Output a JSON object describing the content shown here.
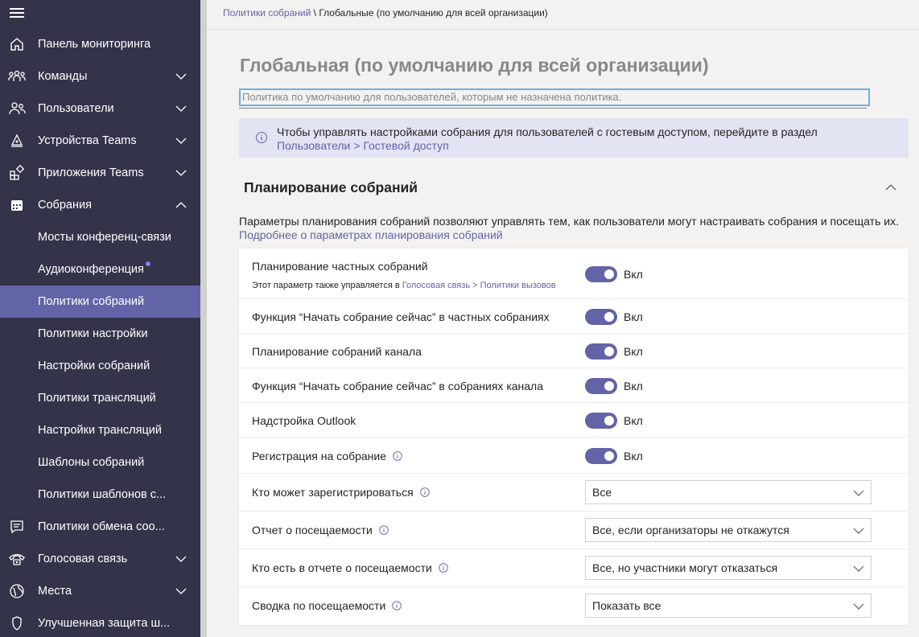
{
  "sidebar": {
    "items": [
      {
        "label": "Панель мониторинга",
        "icon": "home-icon",
        "expandable": false
      },
      {
        "label": "Команды",
        "icon": "teams-icon",
        "expandable": true
      },
      {
        "label": "Пользователи",
        "icon": "users-icon",
        "expandable": true
      },
      {
        "label": "Устройства Teams",
        "icon": "devices-icon",
        "expandable": true
      },
      {
        "label": "Приложения Teams",
        "icon": "apps-icon",
        "expandable": true
      },
      {
        "label": "Собрания",
        "icon": "calendar-icon",
        "expandable": true,
        "expanded": true
      },
      {
        "label": "Мосты конференц-связи",
        "sub": true
      },
      {
        "label": "Аудиоконференция",
        "sub": true,
        "badge_dot": true
      },
      {
        "label": "Политики собраний",
        "sub": true,
        "active": true
      },
      {
        "label": "Политики настройки",
        "sub": true
      },
      {
        "label": "Настройки собраний",
        "sub": true
      },
      {
        "label": "Политики трансляций",
        "sub": true
      },
      {
        "label": "Настройки трансляций",
        "sub": true
      },
      {
        "label": "Шаблоны собраний",
        "sub": true
      },
      {
        "label": "Политики шаблонов с...",
        "sub": true
      },
      {
        "label": "Политики обмена соо...",
        "icon": "messaging-icon",
        "expandable": false
      },
      {
        "label": "Голосовая связь",
        "icon": "phone-icon",
        "expandable": true
      },
      {
        "label": "Места",
        "icon": "globe-icon",
        "expandable": true
      },
      {
        "label": "Улучшенная защита ш...",
        "icon": "shield-icon",
        "expandable": false
      }
    ]
  },
  "breadcrumb": {
    "link": "Политики собраний",
    "separator": " \\ ",
    "current": "Глобальные (по умолчанию для всей организации)"
  },
  "page": {
    "title": "Глобальная (по умолчанию для всей организации)",
    "description_value": "Политика по умолчанию для пользователей, которым не назначена политика."
  },
  "banner": {
    "text": "Чтобы управлять настройками собрания для пользователей с гостевым доступом, перейдите в раздел",
    "link": "Пользователи > Гостевой доступ"
  },
  "section": {
    "title": "Планирование собраний",
    "description": "Параметры планирования собраний позволяют управлять тем, как пользователи могут настраивать собрания и посещать их.",
    "link": "Подробнее о параметрах планирования собраний"
  },
  "settings": [
    {
      "label": "Планирование частных собраний",
      "sub_prefix": "Этот параметр также управляется в ",
      "sub_link": "Голосовая связь > Политики вызовов",
      "type": "toggle",
      "value": "Вкл",
      "on": true
    },
    {
      "label": "Функция “Начать собрание сейчас” в частных собраниях",
      "type": "toggle",
      "value": "Вкл",
      "on": true
    },
    {
      "label": "Планирование собраний канала",
      "type": "toggle",
      "value": "Вкл",
      "on": true
    },
    {
      "label": "Функция “Начать собрание сейчас” в собраниях канала",
      "type": "toggle",
      "value": "Вкл",
      "on": true
    },
    {
      "label": "Надстройка Outlook",
      "type": "toggle",
      "value": "Вкл",
      "on": true
    },
    {
      "label": "Регистрация на собрание",
      "info": true,
      "type": "toggle",
      "value": "Вкл",
      "on": true
    },
    {
      "label": "Кто может зарегистрироваться",
      "info": true,
      "type": "dropdown",
      "value": "Все"
    },
    {
      "label": "Отчет о посещаемости",
      "info": true,
      "type": "dropdown",
      "value": "Все, если организаторы не откажутся"
    },
    {
      "label": "Кто есть в отчете о посещаемости",
      "info": true,
      "type": "dropdown",
      "value": "Все, но участники могут отказаться"
    },
    {
      "label": "Сводка по посещаемости",
      "info": true,
      "type": "dropdown",
      "value": "Показать все"
    }
  ],
  "colors": {
    "sidebar_bg": "#33344a",
    "accent": "#6264a7",
    "banner_bg": "#e2e3f3"
  }
}
